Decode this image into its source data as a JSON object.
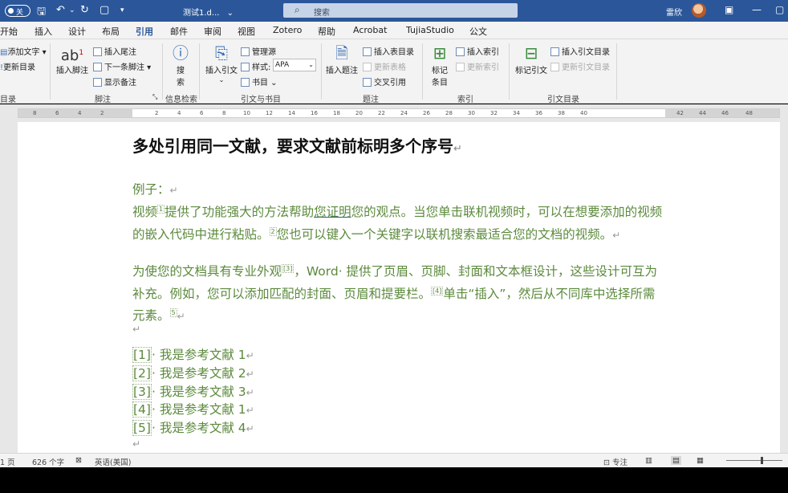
{
  "titlebar": {
    "autosave_label": "关",
    "doc_title": "测试1.d...",
    "doc_title_arrow": "⌄",
    "search_placeholder": "搜索",
    "user_name": "雷欣",
    "icons": [
      "save-icon",
      "undo-icon",
      "redo-icon",
      "customize-icon",
      "search-icon",
      "ribbon-display-icon",
      "minimize-icon",
      "maximize-icon"
    ]
  },
  "tabs": [
    {
      "label": "开始"
    },
    {
      "label": "插入"
    },
    {
      "label": "设计"
    },
    {
      "label": "布局"
    },
    {
      "label": "引用",
      "active": true
    },
    {
      "label": "邮件"
    },
    {
      "label": "审阅"
    },
    {
      "label": "视图"
    },
    {
      "label": "Zotero"
    },
    {
      "label": "帮助"
    },
    {
      "label": "Acrobat"
    },
    {
      "label": "TujiaStudio"
    },
    {
      "label": "公文"
    }
  ],
  "ribbon": {
    "toc": {
      "add_text": "添加文字",
      "update_toc": "更新目录",
      "group": "目录"
    },
    "footnotes": {
      "insert_footnote": "插入脚注",
      "insert_endnote": "插入尾注",
      "next_footnote": "下一条脚注",
      "show_notes": "显示备注",
      "group": "脚注",
      "big_icon_text": "ab",
      "superscript": "1"
    },
    "research": {
      "search": "搜",
      "search2": "索",
      "group": "信息检索"
    },
    "citations": {
      "insert_citation": "插入引文",
      "manage_sources": "管理源",
      "style_label": "样式:",
      "style_value": "APA",
      "bibliography": "书目",
      "group": "引文与书目"
    },
    "captions": {
      "insert_caption": "插入题注",
      "insert_table_of_figures": "插入表目录",
      "update_table": "更新表格",
      "cross_reference": "交叉引用",
      "group": "题注"
    },
    "index": {
      "mark_entry": "标记",
      "mark_entry2": "条目",
      "insert_index": "插入索引",
      "update_index": "更新索引",
      "group": "索引"
    },
    "toa": {
      "mark_citation": "标记引文",
      "insert_toa": "插入引文目录",
      "update_toa": "更新引文目录",
      "group": "引文目录"
    }
  },
  "ruler": {
    "numbers": [
      "8",
      "6",
      "4",
      "2",
      "2",
      "4",
      "6",
      "8",
      "10",
      "12",
      "14",
      "16",
      "18",
      "20",
      "22",
      "24",
      "26",
      "28",
      "30",
      "32",
      "34",
      "36",
      "38",
      "40",
      "42",
      "44",
      "46",
      "48"
    ]
  },
  "document": {
    "heading": "多处引用同一文献，要求文献前标明多个序号",
    "example_label": "例子：",
    "para1": {
      "a": "视频",
      "b": "提供了功能强大的方法帮助",
      "c": "您证明",
      "d": "您的观点。当您单击联机视频时，可以在想要添加的视频的嵌入代码中进行粘贴。",
      "e": "您也可以键入一个关键字以联机搜索最适合您的文档的视频。"
    },
    "para2": {
      "a": "为使您的文档具有专业外观",
      "cite3": "[3]",
      "b": "，Word· 提供了页眉、页脚、封面和文本框设计，这些设计可互为补充。例如，您可以添加匹配的封面、页眉和提要栏。",
      "cite4": "[4]",
      "c": "单击“插入”，然后从不同库中选择所需元素。"
    },
    "para_mark": "↵",
    "references": [
      {
        "num": "[1]",
        "text": "· 我是参考文献 1"
      },
      {
        "num": "[2]",
        "text": "· 我是参考文献 2"
      },
      {
        "num": "[3]",
        "text": "· 我是参考文献 3"
      },
      {
        "num": "[4]",
        "text": "· 我是参考文献 1"
      },
      {
        "num": "[5]",
        "text": "· 我是参考文献 4"
      }
    ]
  },
  "statusbar": {
    "page": "1 页",
    "words": "626 个字",
    "language": "英语(美国)",
    "focus": "专注"
  }
}
